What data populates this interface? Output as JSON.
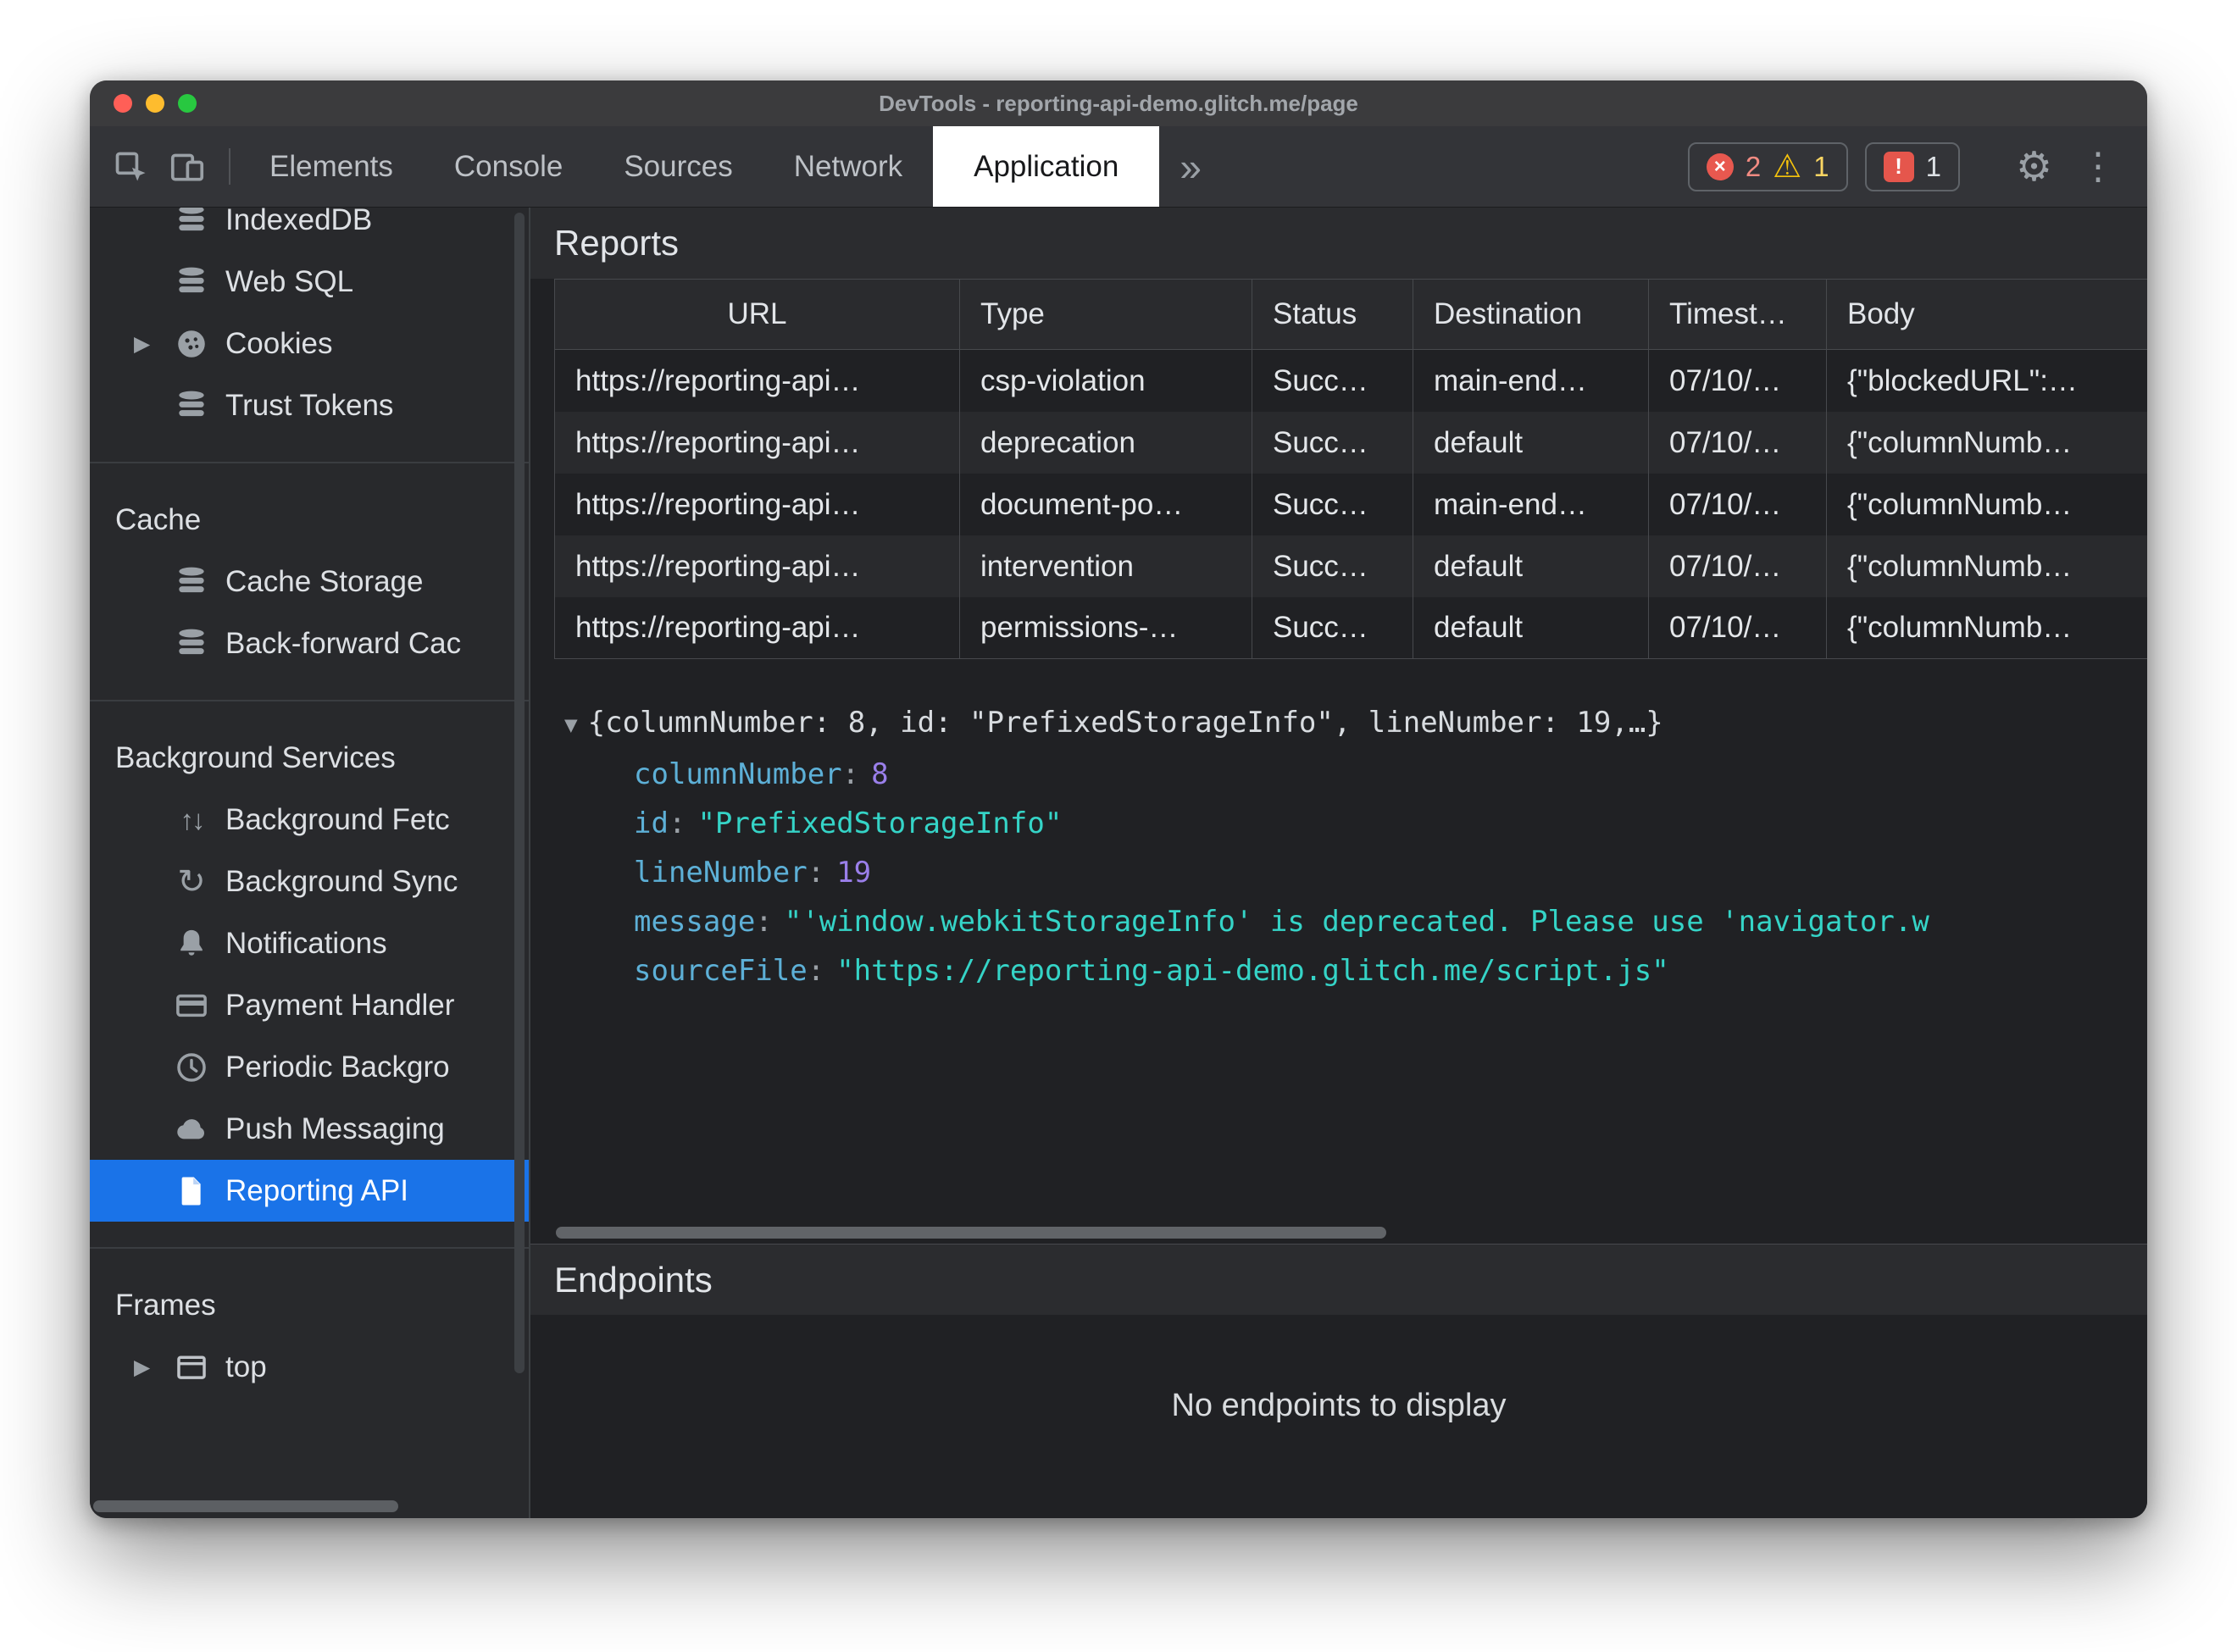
{
  "window": {
    "title": "DevTools - reporting-api-demo.glitch.me/page"
  },
  "toolbar": {
    "tabs": [
      "Elements",
      "Console",
      "Sources",
      "Network",
      "Application"
    ],
    "selected_tab": "Application",
    "errors": {
      "count": "2"
    },
    "warnings": {
      "count": "1"
    },
    "issues": {
      "count": "1"
    }
  },
  "sidebar": {
    "storage_items": [
      {
        "label": "IndexedDB"
      },
      {
        "label": "Web SQL"
      },
      {
        "label": "Cookies"
      },
      {
        "label": "Trust Tokens"
      }
    ],
    "cache_section": {
      "title": "Cache",
      "items": [
        {
          "label": "Cache Storage"
        },
        {
          "label": "Back-forward Cac"
        }
      ]
    },
    "background_section": {
      "title": "Background Services",
      "items": [
        {
          "label": "Background Fetc"
        },
        {
          "label": "Background Sync"
        },
        {
          "label": "Notifications"
        },
        {
          "label": "Payment Handler"
        },
        {
          "label": "Periodic Backgro"
        },
        {
          "label": "Push Messaging"
        },
        {
          "label": "Reporting API"
        }
      ],
      "selected_item": "Reporting API"
    },
    "frames_section": {
      "title": "Frames",
      "items": [
        {
          "label": "top"
        }
      ]
    }
  },
  "reports": {
    "title": "Reports",
    "columns": [
      "URL",
      "Type",
      "Status",
      "Destination",
      "Timest…",
      "Body"
    ],
    "rows": [
      {
        "url": "https://reporting-api…",
        "type": "csp-violation",
        "status": "Succ…",
        "destination": "main-end…",
        "timestamp": "07/10/…",
        "body": "{\"blockedURL\":…"
      },
      {
        "url": "https://reporting-api…",
        "type": "deprecation",
        "status": "Succ…",
        "destination": "default",
        "timestamp": "07/10/…",
        "body": "{\"columnNumb…"
      },
      {
        "url": "https://reporting-api…",
        "type": "document-po…",
        "status": "Succ…",
        "destination": "main-end…",
        "timestamp": "07/10/…",
        "body": "{\"columnNumb…"
      },
      {
        "url": "https://reporting-api…",
        "type": "intervention",
        "status": "Succ…",
        "destination": "default",
        "timestamp": "07/10/…",
        "body": "{\"columnNumb…"
      },
      {
        "url": "https://reporting-api…",
        "type": "permissions-…",
        "status": "Succ…",
        "destination": "default",
        "timestamp": "07/10/…",
        "body": "{\"columnNumb…"
      }
    ]
  },
  "detail": {
    "expander_glyph": "▼",
    "preview": "{columnNumber: 8, id: \"PrefixedStorageInfo\", lineNumber: 19,…}",
    "properties": [
      {
        "key": "columnNumber",
        "value": "8",
        "kind": "number"
      },
      {
        "key": "id",
        "value": "\"PrefixedStorageInfo\"",
        "kind": "string"
      },
      {
        "key": "lineNumber",
        "value": "19",
        "kind": "number"
      },
      {
        "key": "message",
        "value": "\"'window.webkitStorageInfo' is deprecated. Please use 'navigator.w",
        "kind": "string"
      },
      {
        "key": "sourceFile",
        "value": "\"https://reporting-api-demo.glitch.me/script.js\"",
        "kind": "string"
      }
    ]
  },
  "endpoints": {
    "title": "Endpoints",
    "empty_message": "No endpoints to display"
  },
  "glyphs": {
    "collapsed": "▶",
    "colon": ":",
    "gear": "⚙",
    "kebab": "⋮",
    "more": "»",
    "fetch_arrows": "↑↓",
    "sync": "↻",
    "warning": "⚠",
    "error_x": "×",
    "issue_mark": "!"
  },
  "colors": {
    "accent_blue": "#1a73e8",
    "error_red": "#e8584f",
    "warning_yellow": "#f4c20d",
    "key_cyan": "#5db0d7",
    "string_teal": "#35d4c7",
    "number_purple": "#9a7fea"
  }
}
